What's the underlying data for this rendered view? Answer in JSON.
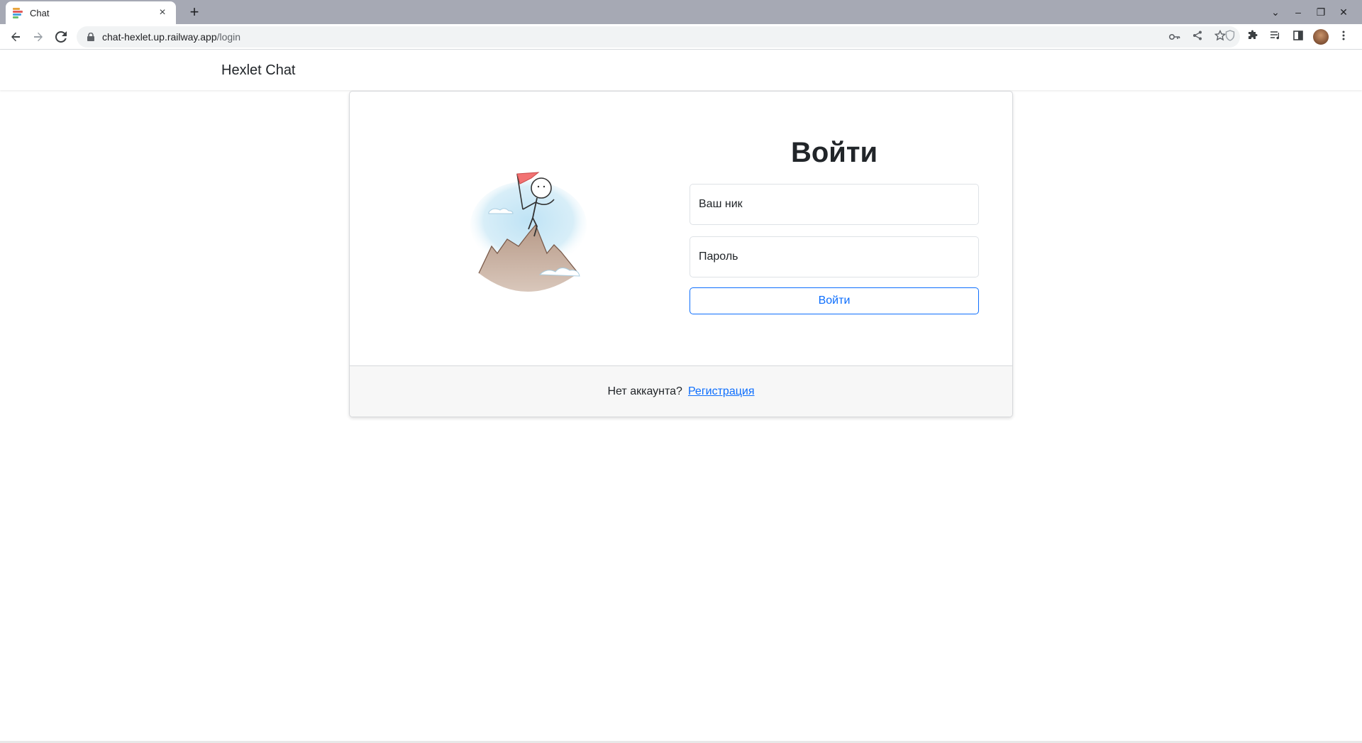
{
  "browser": {
    "tab_title": "Chat",
    "tab_close": "×",
    "new_tab": "+",
    "url_host": "chat-hexlet.up.railway.app",
    "url_path": "/login",
    "window_controls": [
      "⌄",
      "–",
      "❐",
      "✕"
    ]
  },
  "navbar": {
    "brand": "Hexlet Chat"
  },
  "login": {
    "title": "Войти",
    "username_placeholder": "Ваш ник",
    "password_placeholder": "Пароль",
    "submit_label": "Войти"
  },
  "footer": {
    "prompt": "Нет аккаунта?",
    "signup_link": "Регистрация"
  },
  "colors": {
    "accent": "#0d6efd",
    "tabstrip": "#a6a9b4",
    "footer_bg": "#f7f7f7",
    "text": "#212529"
  },
  "icons": {
    "favicon": "hexlet-favicon-icon",
    "back": "arrow-left-icon",
    "forward": "arrow-right-icon",
    "reload": "reload-icon",
    "lock": "lock-icon",
    "key": "key-icon",
    "share": "share-icon",
    "bookmark": "star-icon",
    "shield": "shield-icon",
    "extensions": "puzzle-icon",
    "media": "media-queue-icon",
    "sidepanel": "side-panel-icon",
    "menu": "kebab-menu-icon",
    "illustration": "mountain-climber-illustration"
  }
}
